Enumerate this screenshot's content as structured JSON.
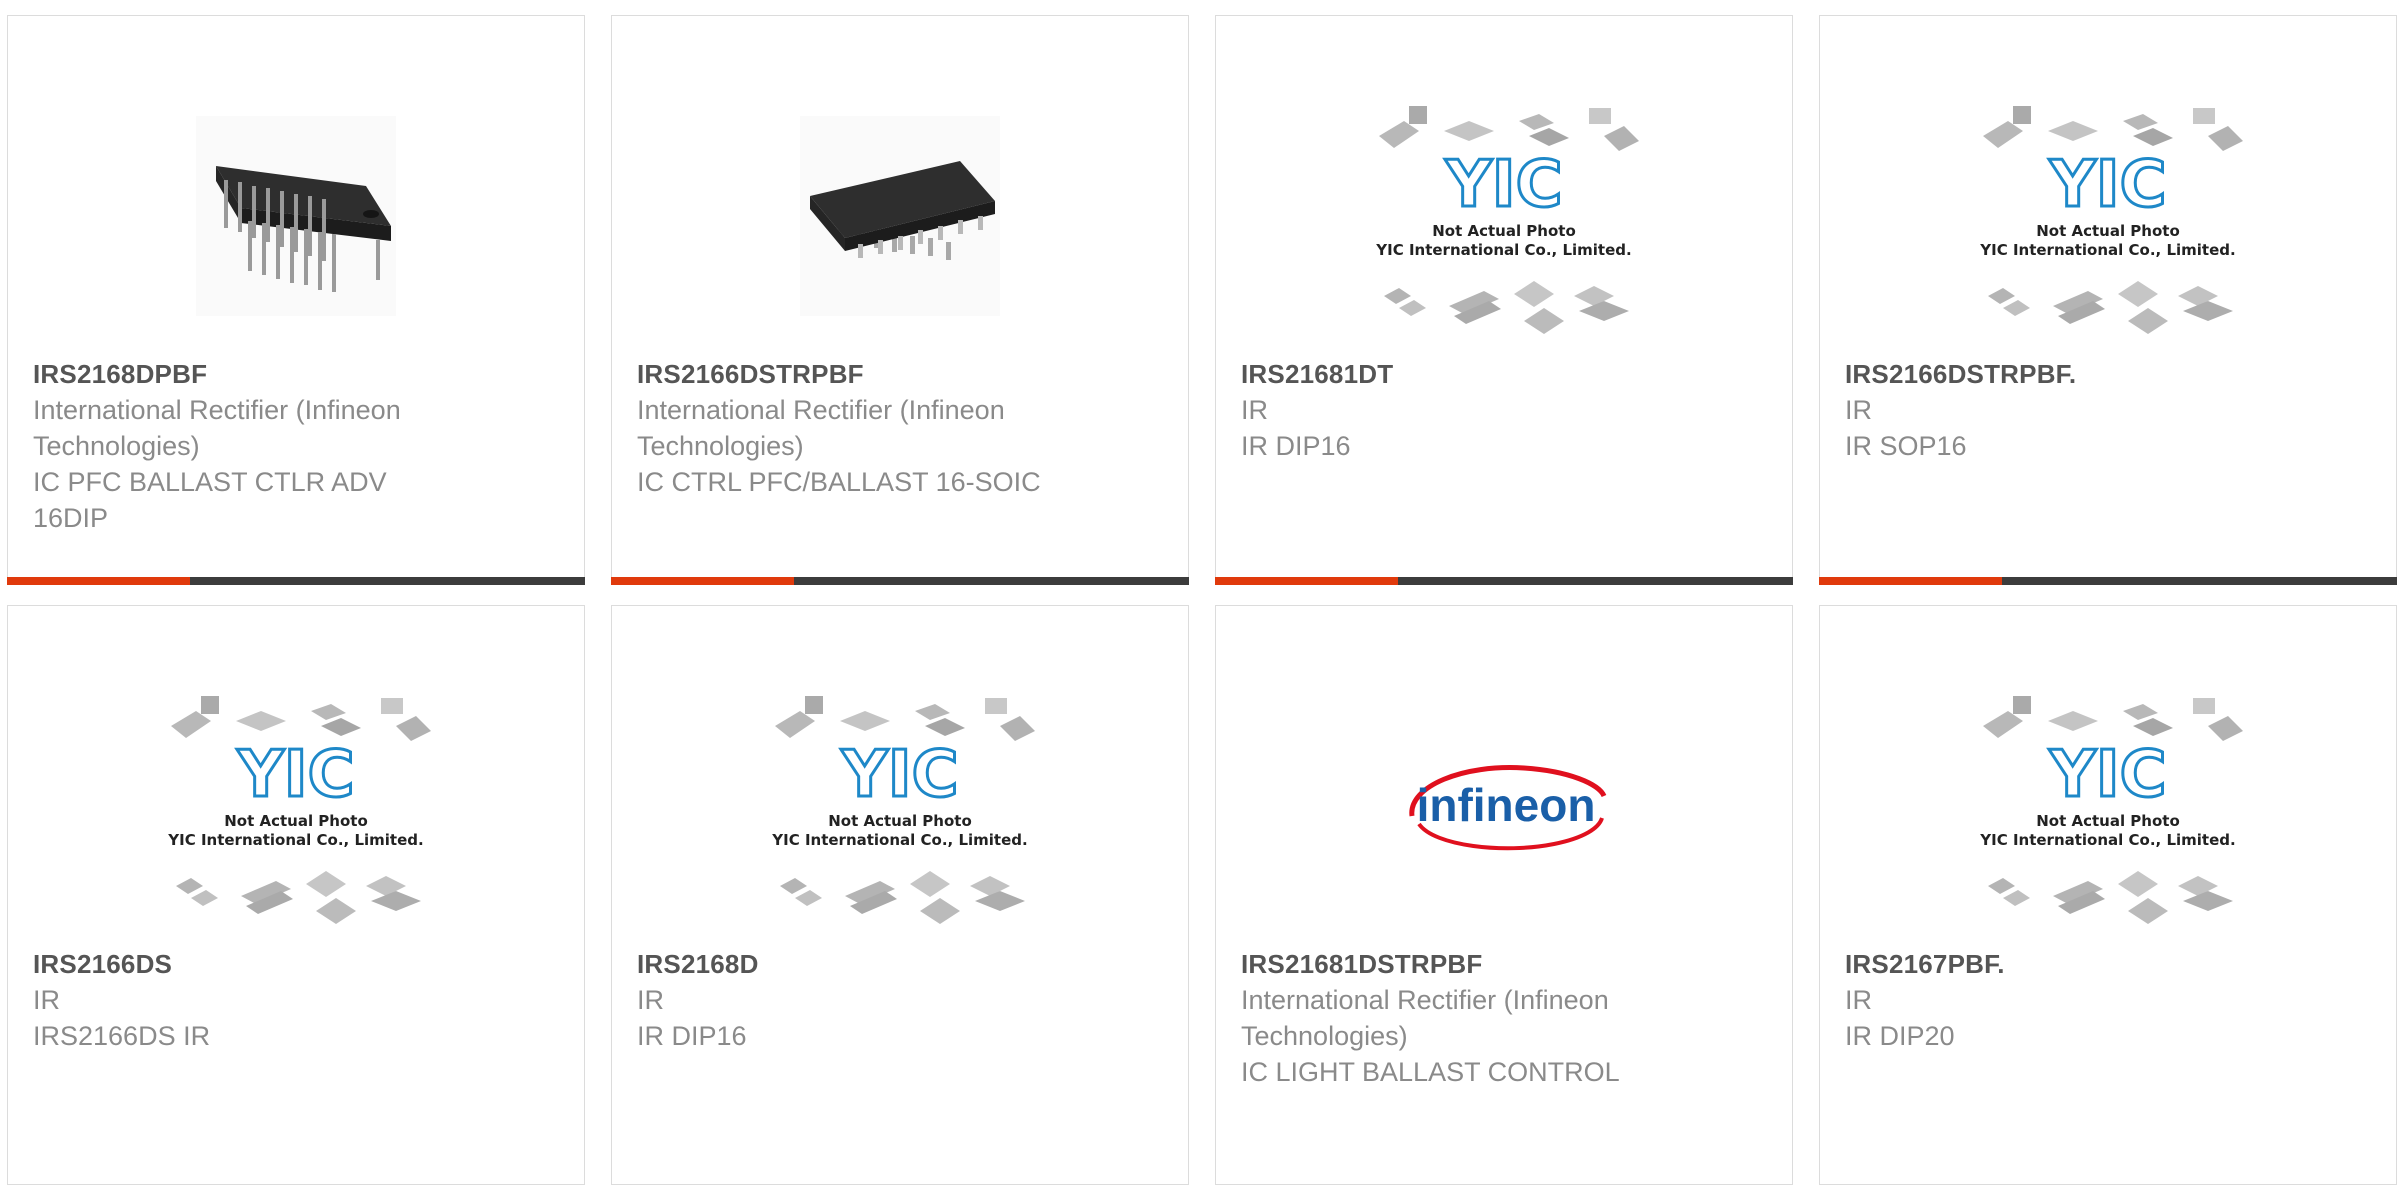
{
  "products": [
    {
      "part": "IRS2168DPBF",
      "manufacturer": "International Rectifier (Infineon Technologies)",
      "description": "IC PFC BALLAST CTLR ADV 16DIP",
      "image": "dip16-chip-photo"
    },
    {
      "part": "IRS2166DSTRPBF",
      "manufacturer": "International Rectifier (Infineon Technologies)",
      "description": "IC CTRL PFC/BALLAST 16-SOIC",
      "image": "soic16-chip-photo"
    },
    {
      "part": "IRS21681DT",
      "manufacturer": "IR",
      "description": "IR DIP16",
      "image": "yic-not-actual-photo",
      "placeholder_line1": "Not Actual Photo",
      "placeholder_line2": "YIC International Co., Limited.",
      "placeholder_logo": "YIC"
    },
    {
      "part": "IRS2166DSTRPBF.",
      "manufacturer": "IR",
      "description": "IR SOP16",
      "image": "yic-not-actual-photo",
      "placeholder_line1": "Not Actual Photo",
      "placeholder_line2": "YIC International Co., Limited.",
      "placeholder_logo": "YIC"
    },
    {
      "part": "IRS2166DS",
      "manufacturer": "IR",
      "description": "IRS2166DS IR",
      "image": "yic-not-actual-photo",
      "placeholder_line1": "Not Actual Photo",
      "placeholder_line2": "YIC International Co., Limited.",
      "placeholder_logo": "YIC"
    },
    {
      "part": "IRS2168D",
      "manufacturer": "IR",
      "description": "IR DIP16",
      "image": "yic-not-actual-photo",
      "placeholder_line1": "Not Actual Photo",
      "placeholder_line2": "YIC International Co., Limited.",
      "placeholder_logo": "YIC"
    },
    {
      "part": "IRS21681DSTRPBF",
      "manufacturer": "International Rectifier (Infineon Technologies)",
      "description": "IC LIGHT BALLAST CONTROL",
      "image": "infineon-logo",
      "logo_text": "infineon"
    },
    {
      "part": "IRS2167PBF.",
      "manufacturer": "IR",
      "description": "IR DIP20",
      "image": "yic-not-actual-photo",
      "placeholder_line1": "Not Actual Photo",
      "placeholder_line2": "YIC International Co., Limited.",
      "placeholder_logo": "YIC"
    }
  ],
  "colors": {
    "accent": "#e03a0c",
    "bar": "#3c3c3c",
    "part_text": "#555555",
    "meta_text": "#8a8a8a",
    "yic_blue": "#1e88c8",
    "infineon_blue": "#1a5fa8",
    "infineon_red": "#e0101e"
  }
}
